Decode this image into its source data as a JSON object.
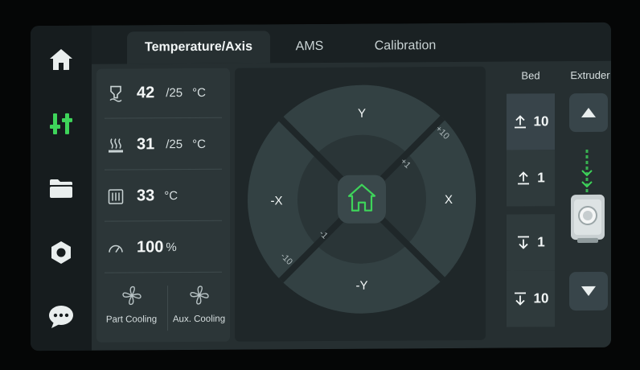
{
  "sidebar": {
    "items": [
      {
        "name": "home",
        "icon": "home-icon"
      },
      {
        "name": "control",
        "icon": "control-sliders-icon",
        "active": true
      },
      {
        "name": "files",
        "icon": "folder-icon"
      },
      {
        "name": "settings",
        "icon": "settings-hex-icon"
      },
      {
        "name": "messages",
        "icon": "chat-bubble-icon"
      }
    ],
    "active_color": "#3ed45a"
  },
  "tabs": [
    {
      "label": "Temperature/Axis",
      "active": true
    },
    {
      "label": "AMS",
      "active": false
    },
    {
      "label": "Calibration",
      "active": false
    }
  ],
  "temperatures": {
    "nozzle": {
      "value": "42",
      "target": "/25",
      "unit": "°C",
      "icon": "nozzle-icon"
    },
    "bed": {
      "value": "31",
      "target": "/25",
      "unit": "°C",
      "icon": "heatbed-icon"
    },
    "chamber": {
      "value": "33",
      "unit": "°C",
      "icon": "chamber-icon"
    },
    "speed": {
      "value": "100",
      "unit": "%",
      "icon": "speed-gauge-icon"
    }
  },
  "fans": [
    {
      "label": "Part Cooling",
      "icon": "fan-icon"
    },
    {
      "label": "Aux. Cooling",
      "icon": "fan-icon"
    }
  ],
  "jog": {
    "y_plus": "Y",
    "y_minus": "-Y",
    "x_plus": "X",
    "x_minus": "-X",
    "step_small_plus": "+1",
    "step_large_plus": "+10",
    "step_small_minus": "-1",
    "step_large_minus": "-10",
    "home_icon": "home-icon",
    "home_color": "#3ed45a"
  },
  "bed_control": {
    "title": "Bed",
    "buttons": [
      {
        "dir": "up",
        "step": "10",
        "icon": "arrow-up-bar-icon"
      },
      {
        "dir": "up",
        "step": "1",
        "icon": "arrow-up-bar-icon"
      },
      {
        "dir": "down",
        "step": "1",
        "icon": "arrow-down-bar-icon"
      },
      {
        "dir": "down",
        "step": "10",
        "icon": "arrow-down-bar-icon"
      }
    ]
  },
  "extruder_control": {
    "title": "Extruder",
    "up_icon": "triangle-up-icon",
    "down_icon": "triangle-down-icon",
    "extruder_icon": "extruder-icon",
    "filament_color": "#3ed45a"
  }
}
